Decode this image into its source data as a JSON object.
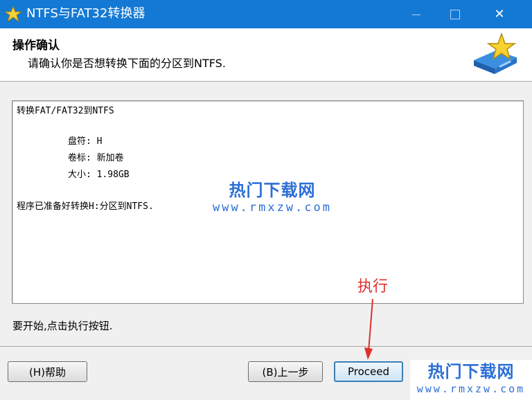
{
  "window": {
    "title": "NTFS与FAT32转换器",
    "min_label": "—",
    "close_label": "✕",
    "icon": "star-app-icon"
  },
  "header": {
    "heading": "操作确认",
    "subheading": "请确认你是否想转换下面的分区到NTFS.",
    "logo_icon": "star-drive-icon"
  },
  "details": {
    "line1": "转换FAT/FAT32到NTFS",
    "drive_letter": "盘符: H",
    "volume_label": "卷标: 新加卷",
    "size": "大小: 1.98GB",
    "ready": "程序已准备好转换H:分区到NTFS."
  },
  "prompt": "要开始,点击执行按钮.",
  "buttons": {
    "help": "(H)帮助",
    "back": "(B)上一步",
    "proceed": "Proceed"
  },
  "annotation": "执行",
  "watermark": {
    "cn": "热门下载网",
    "url": "www.rmxzw.com"
  },
  "colors": {
    "titlebar": "#1479d4",
    "annotation": "#e0302e",
    "watermark": "#2b6fd6"
  }
}
